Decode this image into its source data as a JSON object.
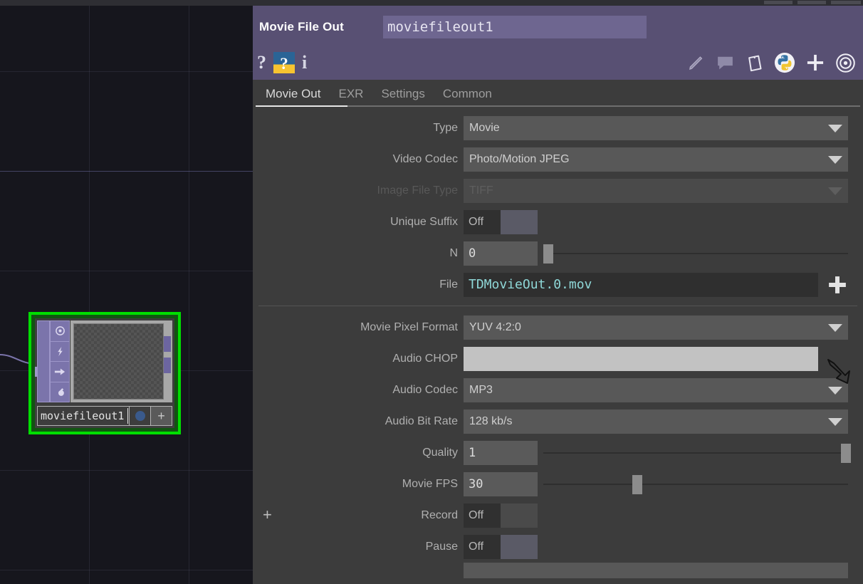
{
  "app": {
    "panel_title": "Movie File Out",
    "operator_name": "moviefileout1"
  },
  "header_icons": {
    "help_label": "?",
    "wiki_label": "?",
    "info_label": "i",
    "left_items": [
      {
        "name": "help-icon",
        "label": "?"
      },
      {
        "name": "wiki-help-icon",
        "label": "?"
      },
      {
        "name": "info-icon",
        "label": "i"
      }
    ],
    "right_items": [
      {
        "name": "edit-pencil-icon"
      },
      {
        "name": "comment-bubble-icon"
      },
      {
        "name": "paste-clipboard-icon"
      },
      {
        "name": "python-icon"
      },
      {
        "name": "add-icon"
      },
      {
        "name": "target-icon"
      }
    ]
  },
  "tabs": [
    {
      "label": "Movie Out",
      "active": true
    },
    {
      "label": "EXR",
      "active": false
    },
    {
      "label": "Settings",
      "active": false
    },
    {
      "label": "Common",
      "active": false
    }
  ],
  "parameters": {
    "type": {
      "label": "Type",
      "value": "Movie"
    },
    "video_codec": {
      "label": "Video Codec",
      "value": "Photo/Motion JPEG"
    },
    "image_file_type": {
      "label": "Image File Type",
      "value": "TIFF",
      "disabled": true
    },
    "unique_suffix": {
      "label": "Unique Suffix",
      "value": "Off"
    },
    "n": {
      "label": "N",
      "value": "0",
      "slider_pct": 0
    },
    "file": {
      "label": "File",
      "value": "TDMovieOut.0.mov"
    },
    "movie_pixel_format": {
      "label": "Movie Pixel Format",
      "value": "YUV 4:2:0"
    },
    "audio_chop": {
      "label": "Audio CHOP",
      "value": ""
    },
    "audio_codec": {
      "label": "Audio Codec",
      "value": "MP3"
    },
    "audio_bit_rate": {
      "label": "Audio Bit Rate",
      "value": "128 kb/s"
    },
    "quality": {
      "label": "Quality",
      "value": "1",
      "slider_pct": 97
    },
    "movie_fps": {
      "label": "Movie FPS",
      "value": "30",
      "slider_pct": 29
    },
    "record": {
      "label": "Record",
      "value": "Off",
      "expand": "+"
    },
    "pause": {
      "label": "Pause",
      "value": "Off"
    }
  },
  "network": {
    "node": {
      "name": "moviefileout1",
      "plus_label": "+",
      "flags": [
        "viewer-flag-icon",
        "bypass-flag-icon",
        "render-flag-icon",
        "clone-flag-icon"
      ]
    }
  },
  "colors": {
    "header_purple": "#585073",
    "header_field": "#6e6690",
    "panel_bg": "#3c3c3c",
    "field_bg": "#585858",
    "network_bg": "#16161d",
    "node_select_green": "#00de00",
    "file_value_teal": "#8fd8d8",
    "active_field": "#c2c2c2",
    "flag_purple": "#7b74ab"
  }
}
